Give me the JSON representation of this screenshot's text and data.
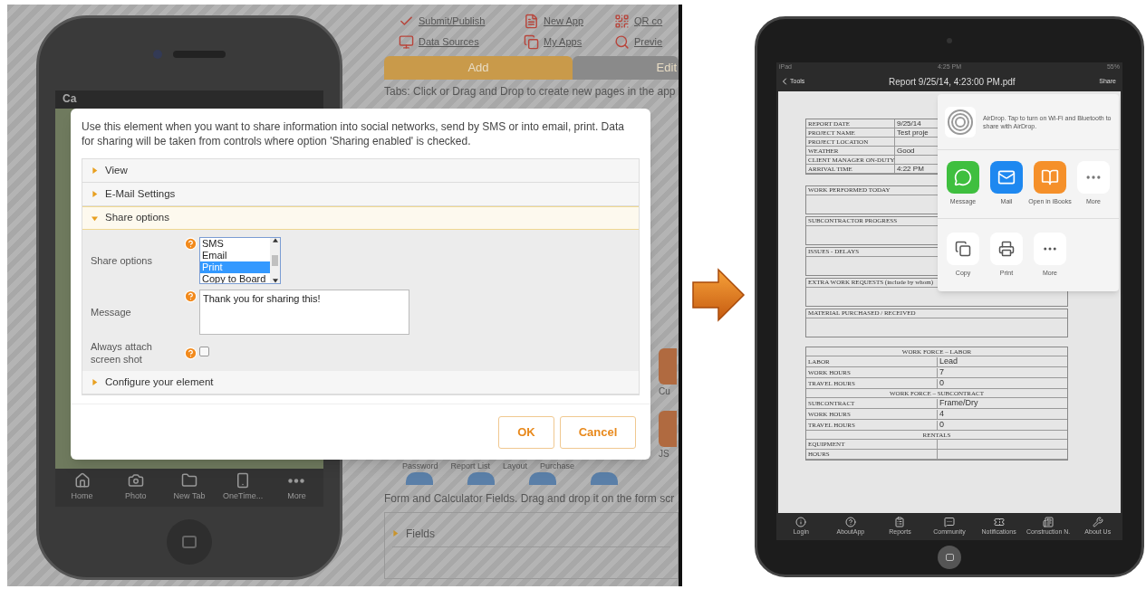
{
  "builder": {
    "phone": {
      "status_text": "Ca",
      "tabs": [
        {
          "label": "Home"
        },
        {
          "label": "Photo"
        },
        {
          "label": "New Tab"
        },
        {
          "label": "OneTime..."
        },
        {
          "label": "More"
        }
      ]
    },
    "toolbar": [
      {
        "label": "Submit/Publish"
      },
      {
        "label": "New App"
      },
      {
        "label": "QR co"
      },
      {
        "label": "Data Sources"
      },
      {
        "label": "My Apps"
      },
      {
        "label": "Previe"
      }
    ],
    "tabs": [
      {
        "label": "Add",
        "selected": true
      },
      {
        "label": "Edit",
        "selected": false
      }
    ],
    "hint": "Tabs: Click or Drag and Drop to create new pages in the app",
    "side_items": [
      {
        "label": "Cu"
      },
      {
        "label": "JS"
      }
    ],
    "palette": [
      {
        "label": "Password"
      },
      {
        "label": "Report List"
      },
      {
        "label": "Layout"
      },
      {
        "label": "Purchase"
      }
    ],
    "fields_hint": "Form and Calculator Fields. Drag and drop it on the form scr",
    "fields_section": "Fields"
  },
  "dialog": {
    "description": "Use this element when you want to share information into social networks, send by SMS or into email, print. Data for sharing will be taken from controls where option 'Sharing enabled' is checked.",
    "sections": [
      {
        "title": "View",
        "expanded": false
      },
      {
        "title": "E-Mail Settings",
        "expanded": false
      },
      {
        "title": "Share options",
        "expanded": true,
        "fields": [
          {
            "kind": "listbox",
            "label": "Share options",
            "options": [
              {
                "label": "SMS",
                "selected": false
              },
              {
                "label": "Email",
                "selected": false
              },
              {
                "label": "Print",
                "selected": true
              },
              {
                "label": "Copy to Board",
                "selected": false
              }
            ]
          },
          {
            "kind": "textarea",
            "label": "Message",
            "value": "Thank you for sharing this!"
          },
          {
            "kind": "checkbox",
            "label": "Always attach screen shot",
            "checked": false
          }
        ]
      },
      {
        "title": "Configure your element",
        "expanded": false
      }
    ],
    "buttons": [
      "OK",
      "Cancel"
    ]
  },
  "ipad": {
    "status": {
      "device": "iPad",
      "time": "4:25 PM",
      "battery": "55%"
    },
    "nav": {
      "back": "Tools",
      "title": "Report 9/25/14, 4:23:00 PM.pdf",
      "action": "Share"
    },
    "report": {
      "info": [
        {
          "label": "REPORT DATE",
          "value": "9/25/14"
        },
        {
          "label": "PROJECT NAME",
          "value": "Test proje"
        },
        {
          "label": "PROJECT LOCATION"
        },
        {
          "label": "WEATHER",
          "value": "Good"
        },
        {
          "label": "CLIENT MANAGER ON-DUTY"
        },
        {
          "label": "ARRIVAL TIME",
          "value": "4:22 PM"
        }
      ],
      "sections": [
        "WORK PERFORMED TODAY",
        "SUBCONTRACTOR PROGRESS",
        "ISSUES - DELAYS",
        "EXTRA WORK REQUESTS (include by whom)",
        "MATERIAL PURCHASED / RECEIVED"
      ],
      "workforce": [
        {
          "kind": "heading",
          "label": "WORK FORCE – LABOR"
        },
        {
          "kind": "row",
          "label": "LABOR",
          "value": "Lead"
        },
        {
          "kind": "row",
          "label": "WORK HOURS",
          "value": "7"
        },
        {
          "kind": "row",
          "label": "TRAVEL HOURS",
          "value": "0"
        },
        {
          "kind": "heading",
          "label": "WORK FORCE – SUBCONTRACT"
        },
        {
          "kind": "row",
          "label": "SUBCONTRACT",
          "value": "Frame/Dry"
        },
        {
          "kind": "row",
          "label": "WORK HOURS",
          "value": "4"
        },
        {
          "kind": "row",
          "label": "TRAVEL HOURS",
          "value": "0"
        },
        {
          "kind": "heading",
          "label": "RENTALS"
        },
        {
          "kind": "row",
          "label": "EQUIPMENT"
        },
        {
          "kind": "row",
          "label": "HOURS"
        }
      ]
    },
    "share_sheet": {
      "airdrop": "AirDrop. Tap to turn on Wi-Fi and Bluetooth to share with AirDrop.",
      "apps": [
        {
          "label": "Message"
        },
        {
          "label": "Mail"
        },
        {
          "label": "Open in iBooks"
        },
        {
          "label": "More"
        }
      ],
      "actions": [
        {
          "label": "Copy"
        },
        {
          "label": "Print"
        },
        {
          "label": "More"
        }
      ]
    },
    "tabs": [
      {
        "label": "Login"
      },
      {
        "label": "AboutApp"
      },
      {
        "label": "Reports"
      },
      {
        "label": "Community"
      },
      {
        "label": "Notifications"
      },
      {
        "label": "Construction N."
      },
      {
        "label": "About Us"
      }
    ]
  }
}
